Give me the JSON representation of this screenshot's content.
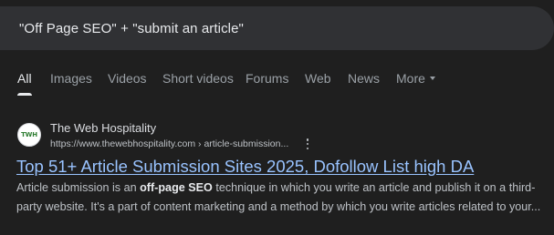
{
  "search": {
    "query": "\"Off Page SEO\" + \"submit an article\""
  },
  "tabs": [
    {
      "label": "All",
      "active": true
    },
    {
      "label": "Images",
      "active": false
    },
    {
      "label": "Videos",
      "active": false
    },
    {
      "label": "Short videos",
      "active": false
    },
    {
      "label": "Forums",
      "active": false
    },
    {
      "label": "Web",
      "active": false
    },
    {
      "label": "News",
      "active": false
    },
    {
      "label": "More",
      "active": false
    }
  ],
  "result": {
    "favicon_text": "TWH",
    "site_name": "The Web Hospitality",
    "url": "https://www.thewebhospitality.com › article-submission...",
    "title": "Top 51+ Article Submission Sites 2025, Dofollow List high DA",
    "snippet": {
      "line1_pre": "Article submission is an ",
      "line1_bold1": "off-page SEO",
      "line1_post": " technique in which you write an article and publish it on a third-",
      "line2": "party website. It's a part of content marketing and a method by which you write articles related to your..."
    }
  },
  "colors": {
    "background": "#1f1f1f",
    "search_bar": "#303134",
    "link": "#99c3ff",
    "text_primary": "#e8eaed",
    "text_secondary": "#9aa0a6",
    "favicon_accent": "#2e7d32"
  }
}
